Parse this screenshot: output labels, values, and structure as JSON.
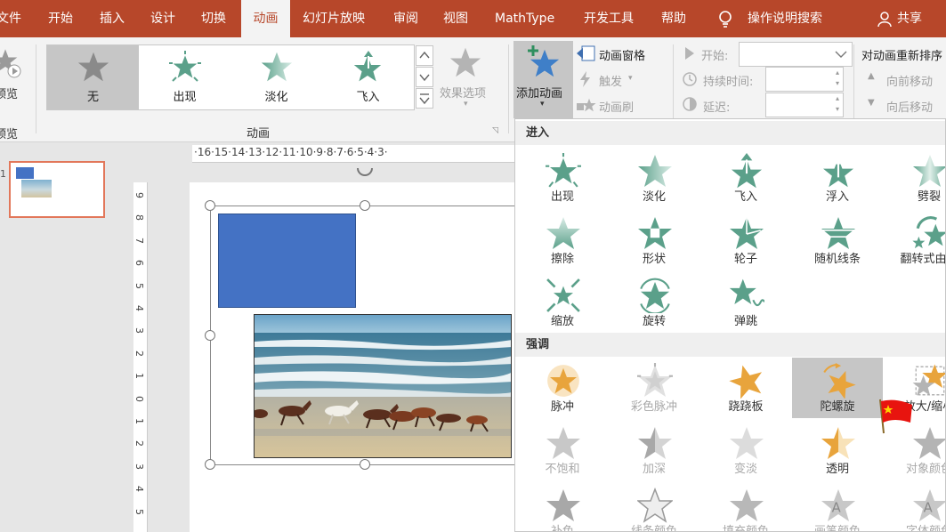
{
  "tabs": [
    "文件",
    "开始",
    "插入",
    "设计",
    "切换",
    "动画",
    "幻灯片放映",
    "审阅",
    "视图",
    "MathType",
    "开发工具",
    "帮助",
    "操作说明搜索",
    "共享"
  ],
  "ribbon": {
    "preview": "预览",
    "preview2": "预览",
    "gallery": [
      "无",
      "出现",
      "淡化",
      "飞入"
    ],
    "effect_options": "效果选项",
    "group_animation": "动画",
    "add_animation": "添加动画",
    "animation_pane": "动画窗格",
    "trigger": "触发",
    "painter": "动画刷",
    "start": "开始:",
    "duration": "持续时间:",
    "delay": "延迟:",
    "reorder": "对动画重新排序",
    "move_earlier": "向前移动",
    "move_later": "向后移动"
  },
  "ruler_h": "·16·15·14·13·12·11·10·9·8·7·6·5·4·3·",
  "ruler_v": [
    "9",
    "8",
    "7",
    "6",
    "5",
    "4",
    "3",
    "2",
    "1",
    "0",
    "1",
    "2",
    "3",
    "4",
    "5"
  ],
  "slide_num": "1",
  "panel": {
    "entrance_title": "进入",
    "entrance": [
      "出现",
      "淡化",
      "飞入",
      "浮入",
      "劈裂",
      "擦除",
      "形状",
      "轮子",
      "随机线条",
      "翻转式由远",
      "缩放",
      "旋转",
      "弹跳"
    ],
    "emphasis_title": "强调",
    "emphasis": [
      "脉冲",
      "彩色脉冲",
      "跷跷板",
      "陀螺旋",
      "放大/缩小",
      "不饱和",
      "加深",
      "变淡",
      "透明",
      "对象颜色",
      "补色",
      "线条颜色",
      "填充颜色",
      "画笔颜色",
      "字体颜色"
    ]
  },
  "colors": {
    "accent": "#b7472a",
    "entrance": "#5ba08a",
    "emphasis": "#e8a43c",
    "disabled": "#b4b4b4",
    "shape": "#4472c4"
  }
}
